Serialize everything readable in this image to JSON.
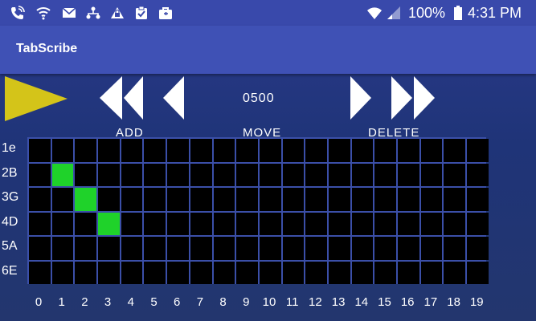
{
  "status_bar": {
    "icons": [
      "wifi-calling-icon",
      "wifi-outline-icon",
      "mail-icon",
      "network-share-icon",
      "vpn-lock-icon",
      "clipboard-check-icon",
      "briefcase-icon",
      "wifi-icon",
      "signal-icon",
      "battery-icon"
    ],
    "battery_pct": "100%",
    "time": "4:31 PM"
  },
  "app_bar": {
    "title": "TabScribe"
  },
  "controls": {
    "counter": "0500",
    "add_label": "ADD",
    "move_label": "MOVE",
    "delete_label": "DELETE",
    "play_color": "#d4c419"
  },
  "grid": {
    "strings": [
      "1e",
      "2B",
      "3G",
      "4D",
      "5A",
      "6E"
    ],
    "frets": [
      "0",
      "1",
      "2",
      "3",
      "4",
      "5",
      "6",
      "7",
      "8",
      "9",
      "10",
      "11",
      "12",
      "13",
      "14",
      "15",
      "16",
      "17",
      "18",
      "19"
    ],
    "active": [
      [
        1,
        1
      ],
      [
        2,
        2
      ],
      [
        3,
        3
      ]
    ],
    "active_color": "#1fd22a"
  }
}
